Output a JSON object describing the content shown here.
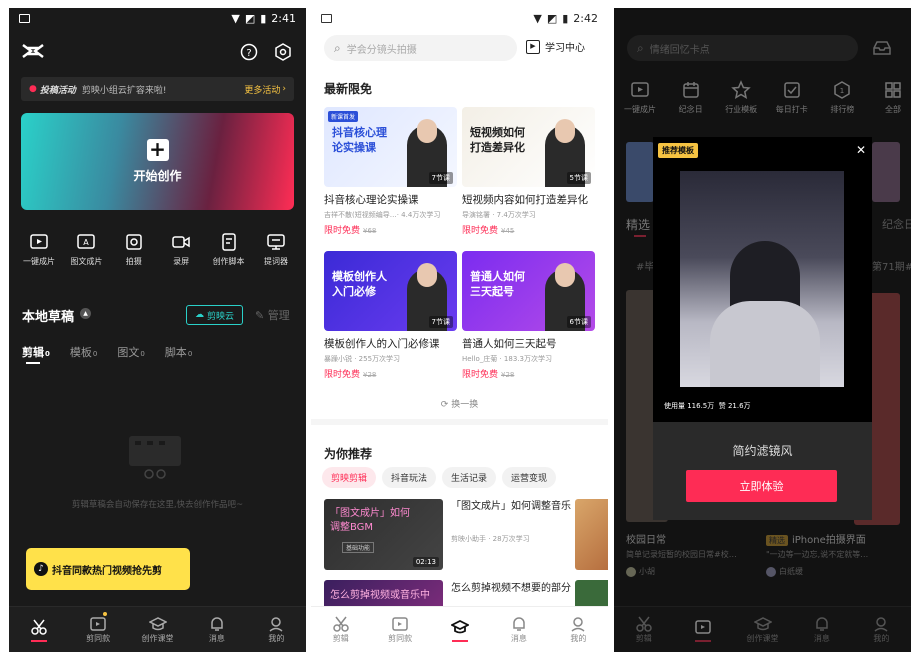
{
  "colors": {
    "accent": "#fe2c55",
    "teal": "#2ad1c9",
    "dark": "#1a1a1a"
  },
  "p1": {
    "time": "2:41",
    "banner": {
      "tag": "投稿活动",
      "text": "剪映小组云扩容来啦!",
      "link": "更多活动"
    },
    "create": "开始创作",
    "icons": [
      {
        "icon": "play-square-icon",
        "label": "一键成片"
      },
      {
        "icon": "image-text-icon",
        "label": "图文成片"
      },
      {
        "icon": "camera-icon",
        "label": "拍摄"
      },
      {
        "icon": "record-icon",
        "label": "录屏"
      },
      {
        "icon": "script-icon",
        "label": "创作脚本"
      },
      {
        "icon": "prompter-icon",
        "label": "提词器"
      }
    ],
    "drafts_title": "本地草稿",
    "cloud": "剪映云",
    "manage": "管理",
    "tabs": [
      {
        "label": "剪辑",
        "count": "0"
      },
      {
        "label": "模板",
        "count": "0"
      },
      {
        "label": "图文",
        "count": "0"
      },
      {
        "label": "脚本",
        "count": "0"
      }
    ],
    "empty": "剪辑草稿会自动保存在这里,快去创作作品吧~",
    "promo": "抖音同款热门视频抢先剪",
    "nav": [
      "剪辑",
      "剪同款",
      "创作课堂",
      "消息",
      "我的"
    ]
  },
  "p2": {
    "time": "2:42",
    "search_placeholder": "学会分镜头拍摄",
    "learn": "学习中心",
    "section1": "最新限免",
    "cards": [
      {
        "thumb_text": "抖音核心理论实操课",
        "tag": "新课首发",
        "badge": "7节课",
        "title": "抖音核心理论实操课",
        "meta": "吉祥不散(短视频编导…· 4.4万次学习",
        "price": "限时免费",
        "orig": "¥68",
        "c1": "#dfe7ff",
        "c2": "#f4f7ff",
        "tc": "#2b4fd8"
      },
      {
        "thumb_text": "短视频如何打造差异化",
        "tag": "",
        "badge": "5节课",
        "title": "短视频内容如何打造差异化",
        "meta": "导演铭署 · 7.4万次学习",
        "price": "限时免费",
        "orig": "¥45",
        "c1": "#f3efe6",
        "c2": "#ffffff",
        "tc": "#222"
      },
      {
        "thumb_text": "模板创作人入门必修",
        "tag": "",
        "badge": "7节课",
        "title": "模板创作人的入门必修课",
        "meta": "暴躁小锐 · 255万次学习",
        "price": "限时免费",
        "orig": "¥28",
        "c1": "#3b2ad6",
        "c2": "#6a3cf0",
        "tc": "#fff"
      },
      {
        "thumb_text": "普通人如何三天起号",
        "tag": "",
        "badge": "6节课",
        "title": "普通人如何三天起号",
        "meta": "Hello_庄菊 · 183.3万次学习",
        "price": "限时免费",
        "orig": "¥28",
        "c1": "#7b2cf0",
        "c2": "#b44be8",
        "tc": "#fff"
      }
    ],
    "refresh": "换一换",
    "section2": "为你推荐",
    "pills": [
      "剪映剪辑",
      "抖音玩法",
      "生活记录",
      "运营变现"
    ],
    "rec": [
      {
        "thumb_text": "「图文成片」如何调整BGM",
        "sub": "基础功能",
        "dur": "02:13",
        "title": "「图文成片」如何调整音乐",
        "meta": "剪映小助手 · 28万次学习"
      },
      {
        "thumb_text": "怎么剪掉视频或音乐中",
        "title": "怎么剪掉视频不想要的部分"
      }
    ],
    "nav": [
      "剪辑",
      "剪同款",
      "创作课堂",
      "消息",
      "我的"
    ]
  },
  "p3": {
    "search_placeholder": "情绪回忆卡点",
    "icons": [
      {
        "icon": "play-square-icon",
        "label": "一键成片"
      },
      {
        "icon": "calendar-icon",
        "label": "纪念日"
      },
      {
        "icon": "star-icon",
        "label": "行业模板"
      },
      {
        "icon": "checkbox-icon",
        "label": "每日打卡"
      },
      {
        "icon": "rank-icon",
        "label": "排行榜"
      },
      {
        "icon": "grid-icon",
        "label": "全部"
      }
    ],
    "tab": "精选",
    "tab2": "纪念日",
    "tags": [
      "#毕",
      "第71期#"
    ],
    "modal": {
      "tag": "推荐模板",
      "stats": "使用量 116.5万  赞 21.6万",
      "name": "简约滤镜风",
      "button": "立即体验"
    },
    "cards": [
      {
        "title": "校园日常",
        "desc": "简单记录短暂的校园日常#校…",
        "user": "小胡"
      },
      {
        "badge": "精选",
        "title": "iPhone拍摄界面",
        "desc": "\"一边等一边忘,说不定就等…",
        "user": "白纸缓"
      }
    ],
    "nav": [
      "剪辑",
      "剪同款",
      "创作课堂",
      "消息",
      "我的"
    ]
  }
}
